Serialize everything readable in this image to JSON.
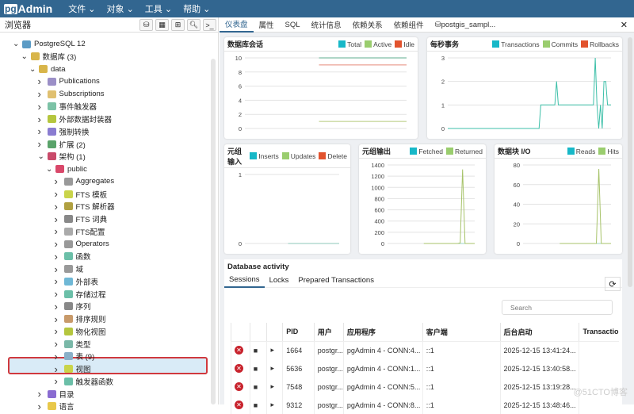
{
  "header": {
    "logo": "pgAdmin",
    "menus": [
      "文件",
      "对象",
      "工具",
      "帮助"
    ]
  },
  "browser": {
    "title": "浏览器",
    "tools": [
      "db-icon",
      "grid-icon",
      "filter-icon",
      "search-icon",
      "terminal-icon"
    ],
    "tree": [
      {
        "label": "PostgreSQL 12",
        "level": 0,
        "open": true,
        "color": "#5b9bc5"
      },
      {
        "label": "数据库 (3)",
        "level": 1,
        "open": true,
        "color": "#d8b54a"
      },
      {
        "label": "data",
        "level": 2,
        "open": true,
        "color": "#d8b54a"
      },
      {
        "label": "Publications",
        "level": 3,
        "color": "#9b8fc7"
      },
      {
        "label": "Subscriptions",
        "level": 3,
        "color": "#e0c070"
      },
      {
        "label": "事件触发器",
        "level": 3,
        "color": "#7cc2a6"
      },
      {
        "label": "外部数据封装器",
        "level": 3,
        "color": "#b5c63e"
      },
      {
        "label": "强制转换",
        "level": 3,
        "color": "#8a7cd1"
      },
      {
        "label": "扩展 (2)",
        "level": 3,
        "color": "#5aa36a"
      },
      {
        "label": "架构 (1)",
        "level": 3,
        "open": true,
        "color": "#c94a6a"
      },
      {
        "label": "public",
        "level": 4,
        "open": true,
        "color": "#d9486a"
      },
      {
        "label": "Aggregates",
        "level": 5,
        "color": "#999"
      },
      {
        "label": "FTS 模板",
        "level": 5,
        "color": "#c9d44a"
      },
      {
        "label": "FTS 解析器",
        "level": 5,
        "color": "#b0a040"
      },
      {
        "label": "FTS 词典",
        "level": 5,
        "color": "#888"
      },
      {
        "label": "FTS配置",
        "level": 5,
        "color": "#aaa"
      },
      {
        "label": "Operators",
        "level": 5,
        "color": "#999"
      },
      {
        "label": "函数",
        "level": 5,
        "color": "#6bbfa8"
      },
      {
        "label": "域",
        "level": 5,
        "color": "#999"
      },
      {
        "label": "外部表",
        "level": 5,
        "color": "#6fb8d6"
      },
      {
        "label": "存储过程",
        "level": 5,
        "color": "#6bbfa8"
      },
      {
        "label": "序列",
        "level": 5,
        "color": "#888"
      },
      {
        "label": "排序规则",
        "level": 5,
        "color": "#c89a6a"
      },
      {
        "label": "物化视图",
        "level": 5,
        "color": "#b5c63e"
      },
      {
        "label": "类型",
        "level": 5,
        "color": "#7ab8a8"
      },
      {
        "label": "表 (9)",
        "level": 5,
        "color": "#8ab0c8",
        "selected": true
      },
      {
        "label": "视图",
        "level": 5,
        "color": "#c9d44a"
      },
      {
        "label": "触发器函数",
        "level": 5,
        "color": "#6bbfa8"
      },
      {
        "label": "目录",
        "level": 3,
        "color": "#8a6cd1"
      },
      {
        "label": "语言",
        "level": 3,
        "color": "#e8c84a"
      }
    ]
  },
  "tabs": [
    "仪表盘",
    "属性",
    "SQL",
    "统计信息",
    "依赖关系",
    "依赖组件",
    "postgis_sampl..."
  ],
  "colors": {
    "c1": "#17b8c8",
    "c2": "#9acd6e",
    "c3": "#e2532e"
  },
  "chart_data": [
    {
      "title": "数据库会话",
      "type": "line",
      "ylim": [
        0,
        10
      ],
      "ticks": [
        0,
        2,
        4,
        6,
        8,
        10
      ],
      "legend": [
        "Total",
        "Active",
        "Idle"
      ],
      "series": [
        {
          "name": "Total",
          "color": "#5fae8f",
          "values": [
            null,
            null,
            null,
            null,
            null,
            null,
            null,
            null,
            null,
            null,
            null,
            10,
            10,
            10,
            10,
            10,
            10,
            10,
            10,
            10,
            10,
            10,
            10,
            10,
            10
          ]
        },
        {
          "name": "Active",
          "color": "#b5c97a",
          "values": [
            null,
            null,
            null,
            null,
            null,
            null,
            null,
            null,
            null,
            null,
            null,
            1,
            1,
            1,
            1,
            1,
            1,
            1,
            1,
            1,
            1,
            1,
            1,
            1,
            1
          ]
        },
        {
          "name": "Idle",
          "color": "#e58a7a",
          "values": [
            null,
            null,
            null,
            null,
            null,
            null,
            null,
            null,
            null,
            null,
            null,
            9,
            9,
            9,
            9,
            9,
            9,
            9,
            9,
            9,
            9,
            9,
            9,
            9,
            9
          ]
        }
      ]
    },
    {
      "title": "每秒事务",
      "type": "line",
      "ylim": [
        0,
        3
      ],
      "ticks": [
        0,
        1,
        2,
        3
      ],
      "legend": [
        "Transactions",
        "Commits",
        "Rollbacks"
      ],
      "series": [
        {
          "name": "Transactions",
          "color": "#3cbfa8",
          "values": [
            0,
            0,
            0,
            0,
            0,
            0,
            0,
            0,
            0,
            0,
            0,
            0,
            0,
            0,
            0,
            0,
            0,
            0,
            0,
            0,
            0,
            0,
            0,
            0,
            0,
            0,
            0,
            0,
            0,
            0,
            0,
            0,
            0,
            0,
            0,
            0,
            0,
            0,
            0,
            0,
            0,
            0,
            0,
            0,
            0,
            0,
            0,
            0,
            0,
            0,
            0,
            0,
            0,
            1,
            1,
            1,
            1,
            1,
            1,
            1,
            1,
            1,
            2,
            1,
            1,
            1,
            1,
            1,
            1,
            1,
            1,
            1,
            1,
            1,
            1,
            1,
            1,
            1,
            1,
            1,
            1,
            1,
            1,
            1,
            3,
            1,
            0,
            1,
            0,
            2,
            2,
            1,
            1,
            1
          ]
        }
      ]
    },
    {
      "title": "元组输入",
      "type": "line",
      "ylim": [
        0,
        1
      ],
      "ticks": [
        0,
        1
      ],
      "legend": [
        "Inserts",
        "Updates",
        "Delete"
      ],
      "series": [
        {
          "name": "Inserts",
          "color": "#8cc7b8",
          "values": [
            null,
            null,
            null,
            null,
            null,
            null,
            null,
            null,
            null,
            null,
            null,
            0,
            0,
            0,
            0,
            0,
            0,
            0,
            0,
            0,
            0,
            0,
            0,
            0,
            0
          ]
        }
      ]
    },
    {
      "title": "元组输出",
      "type": "line",
      "ylim": [
        0,
        1400
      ],
      "ticks": [
        0,
        200,
        400,
        600,
        800,
        1000,
        1200,
        1400
      ],
      "legend": [
        "Fetched",
        "Returned"
      ],
      "series": [
        {
          "name": "Fetched",
          "color": "#9ed4c8",
          "values": [
            null,
            null,
            null,
            null,
            null,
            null,
            null,
            null,
            null,
            null,
            null,
            null,
            null,
            null,
            null,
            0,
            0,
            0,
            0,
            0,
            0,
            0,
            0,
            0,
            0,
            0,
            0,
            0,
            0,
            0,
            0,
            0,
            0,
            0,
            0,
            0,
            0
          ]
        },
        {
          "name": "Returned",
          "color": "#a7c36a",
          "values": [
            null,
            null,
            null,
            null,
            null,
            null,
            null,
            null,
            null,
            null,
            null,
            null,
            null,
            null,
            null,
            0,
            0,
            0,
            0,
            0,
            0,
            0,
            0,
            0,
            0,
            0,
            0,
            0,
            0,
            0,
            10,
            1320,
            0,
            0,
            0,
            0,
            0
          ]
        }
      ]
    },
    {
      "title": "数据块 I/O",
      "type": "line",
      "ylim": [
        0,
        80
      ],
      "ticks": [
        0,
        20,
        40,
        60,
        80
      ],
      "legend": [
        "Reads",
        "Hits"
      ],
      "series": [
        {
          "name": "Reads",
          "color": "#9ed4c8",
          "values": [
            null,
            null,
            null,
            null,
            null,
            null,
            null,
            null,
            null,
            null,
            null,
            null,
            null,
            null,
            null,
            0,
            0,
            0,
            0,
            0,
            0,
            0,
            0,
            0,
            0,
            0,
            0,
            0,
            0,
            0,
            0,
            0,
            0,
            0,
            0,
            0,
            0
          ]
        },
        {
          "name": "Hits",
          "color": "#a7c36a",
          "values": [
            null,
            null,
            null,
            null,
            null,
            null,
            null,
            null,
            null,
            null,
            null,
            null,
            null,
            null,
            null,
            0,
            0,
            0,
            0,
            0,
            0,
            0,
            0,
            0,
            0,
            0,
            0,
            0,
            0,
            0,
            0,
            76,
            0,
            0,
            0,
            0,
            0
          ]
        }
      ]
    }
  ],
  "activity": {
    "title": "Database activity",
    "tabs": [
      "Sessions",
      "Locks",
      "Prepared Transactions"
    ],
    "search_placeholder": "Search",
    "columns": [
      "PID",
      "用户",
      "应用程序",
      "客户端",
      "后台启动",
      "Transactio"
    ],
    "rows": [
      [
        "1664",
        "postgr...",
        "pgAdmin 4 - CONN:4...",
        "::1",
        "2025-12-15 13:41:24...",
        ""
      ],
      [
        "5636",
        "postgr...",
        "pgAdmin 4 - CONN:1...",
        "::1",
        "2025-12-15 13:40:58...",
        ""
      ],
      [
        "7548",
        "postgr...",
        "pgAdmin 4 - CONN:5...",
        "::1",
        "2025-12-15 13:19:28...",
        ""
      ],
      [
        "9312",
        "postgr...",
        "pgAdmin 4 - CONN:8...",
        "::1",
        "2025-12-15 13:48:46...",
        ""
      ]
    ]
  },
  "watermark": "@51CTO博客"
}
